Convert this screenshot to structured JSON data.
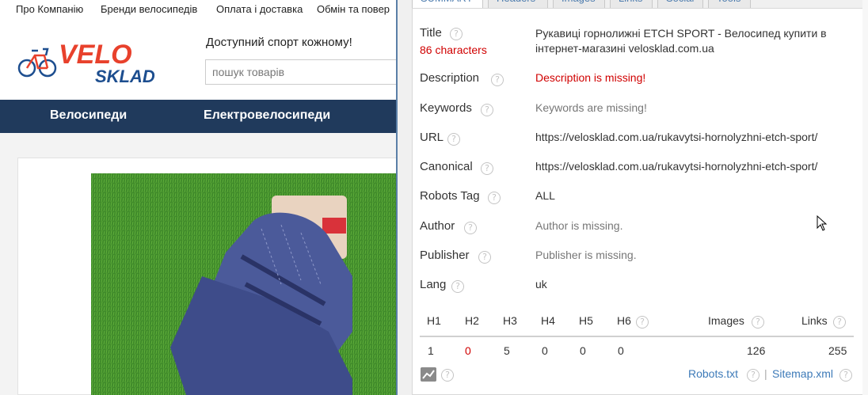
{
  "site": {
    "topnav": [
      "Про Компанію",
      "Бренди велосипедів",
      "Оплата і доставка",
      "Обмін та повер"
    ],
    "logo_text_top": "VELO",
    "logo_text_bottom": "SKLAD",
    "slogan": "Доступний спорт кожному!",
    "search_placeholder": "пошук товарів",
    "categories": [
      "Велосипеди",
      "Електровелосипеди"
    ],
    "colors": {
      "accent": "#e8412c",
      "nav": "#203a5c",
      "logo_blue": "#1d4e8f"
    }
  },
  "popup": {
    "tabs": [
      "SUMMARY",
      "Headers",
      "Images",
      "Links",
      "Social",
      "Tools"
    ],
    "active_tab": "SUMMARY",
    "rows": {
      "title": {
        "label": "Title",
        "sub": "86 characters",
        "value_line1": "Рукавиці горнолижні ETCH SPORT - Велосипед купити в",
        "value_line2": "інтернет-магазині velosklad.com.ua"
      },
      "description": {
        "label": "Description",
        "value": "Description is missing!"
      },
      "keywords": {
        "label": "Keywords",
        "value": "Keywords are missing!"
      },
      "url": {
        "label": "URL",
        "value": "https://velosklad.com.ua/rukavytsi-hornolyzhni-etch-sport/"
      },
      "canonical": {
        "label": "Canonical",
        "value": "https://velosklad.com.ua/rukavytsi-hornolyzhni-etch-sport/"
      },
      "robots": {
        "label": "Robots Tag",
        "value": "ALL"
      },
      "author": {
        "label": "Author",
        "value": "Author is missing."
      },
      "publisher": {
        "label": "Publisher",
        "value": "Publisher is missing."
      },
      "lang": {
        "label": "Lang",
        "value": "uk"
      }
    },
    "headings": {
      "labels": [
        "H1",
        "H2",
        "H3",
        "H4",
        "H5",
        "H6"
      ],
      "values": [
        "1",
        "0",
        "5",
        "0",
        "0",
        "0"
      ],
      "images_label": "Images",
      "images_value": "126",
      "links_label": "Links",
      "links_value": "255"
    },
    "footer": {
      "robots": "Robots.txt",
      "separator": "|",
      "sitemap": "Sitemap.xml"
    },
    "help_glyph": "?",
    "colors": {
      "link": "#3d7ab8",
      "error": "#d00000",
      "tab_border": "#5a7fa7"
    }
  }
}
